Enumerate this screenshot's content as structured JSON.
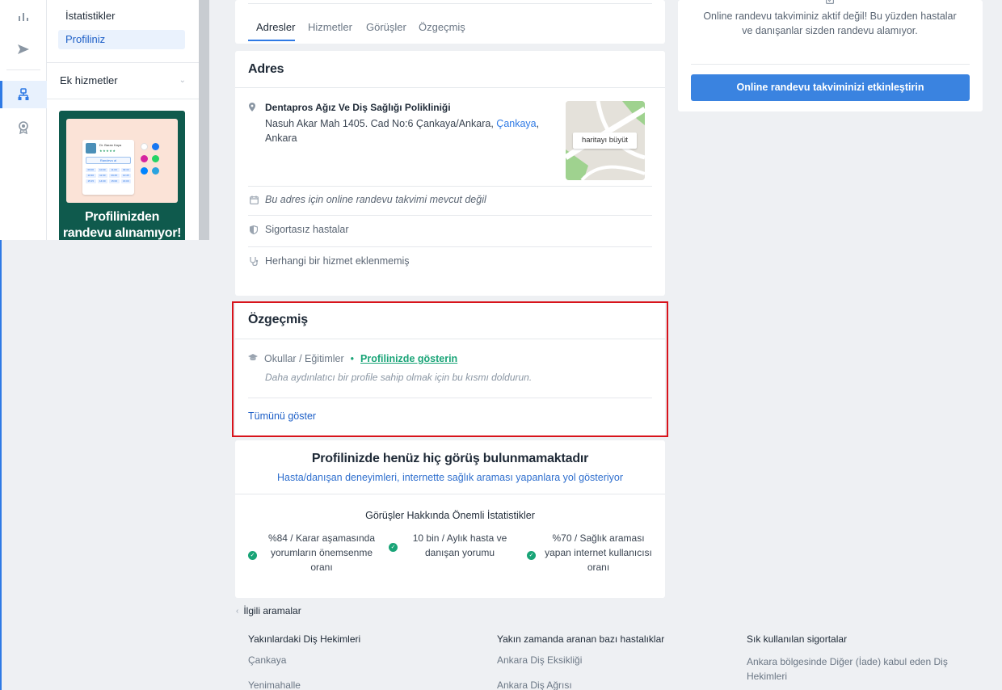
{
  "sidebar": {
    "items": [
      {
        "label": "İstatistikler",
        "selected": false
      },
      {
        "label": "Profiliniz",
        "selected": true
      }
    ],
    "section": "Ek hizmetler",
    "promo": {
      "card_name": "Dr. Baran Kaya",
      "card_stars": "★★★★★",
      "card_button": "Randevu al",
      "slots": [
        "09:00",
        "10:00",
        "11:00",
        "09:30",
        "10:30",
        "11:30",
        "09:45",
        "10:45",
        "15:15",
        "14:00",
        "15:00",
        "16:00"
      ],
      "text": "Profilinizden randevu alınamıyor!"
    }
  },
  "tabs": {
    "items": [
      "Adresler",
      "Hizmetler",
      "Görüşler",
      "Özgeçmiş"
    ],
    "active": "Adresler"
  },
  "address": {
    "title": "Adres",
    "clinic": "Dentapros Ağız Ve Diş Sağlığı Polikliniği",
    "street": "Nasuh Akar Mah 1405. Cad No:6 Çankaya/Ankara,",
    "district_link": "Çankaya",
    "city": "Ankara",
    "map_button": "haritayı büyüt",
    "rows": [
      {
        "icon": "calendar-icon",
        "text": "Bu adres için online randevu takvimi mevcut değil",
        "italic": true
      },
      {
        "icon": "shield-icon",
        "text": "Sigortasız hastalar",
        "italic": false
      },
      {
        "icon": "stethoscope-icon",
        "text": "Herhangi bir hizmet eklenmemiş",
        "italic": false
      }
    ]
  },
  "ozgecmis": {
    "title": "Özgeçmiş",
    "row_label": "Okullar / Eğitimler",
    "row_link": "Profilinizde gösterin",
    "hint": "Daha aydınlatıcı bir profile sahip olmak için bu kısmı doldurun.",
    "show_all": "Tümünü göster"
  },
  "reviews": {
    "title": "Profilinizde henüz hiç görüş bulunmamaktadır",
    "subtitle": "Hasta/danışan deneyimleri, internette sağlık araması yapanlara yol gösteriyor",
    "stats_title": "Görüşler Hakkında Önemli İstatistikler",
    "stats": [
      "%84 / Karar aşamasında yorumların önemsenme oranı",
      "10 bin / Aylık hasta ve danışan yorumu",
      "%70 / Sağlık araması yapan internet kullanıcısı oranı"
    ]
  },
  "related": {
    "title": "İlgili aramalar",
    "columns": [
      {
        "heading": "Yakınlardaki Diş Hekimleri",
        "items": [
          "Çankaya",
          "Yenimahalle"
        ]
      },
      {
        "heading": "Yakın zamanda aranan bazı hastalıklar",
        "items": [
          "Ankara Diş Eksikliği",
          "Ankara Diş Ağrısı"
        ]
      },
      {
        "heading": "Sık kullanılan sigortalar",
        "items": [
          "Ankara bölgesinde Diğer (İade) kabul eden Diş Hekimleri"
        ]
      }
    ]
  },
  "calendar_card": {
    "message": "Online randevu takviminiz aktif değil! Bu yüzden hastalar ve danışanlar sizden randevu alamıyor.",
    "button": "Online randevu takviminizi etkinleştirin"
  },
  "colors": {
    "accent": "#2f7ae5",
    "success": "#19a477",
    "highlight_border": "#d8131b"
  }
}
